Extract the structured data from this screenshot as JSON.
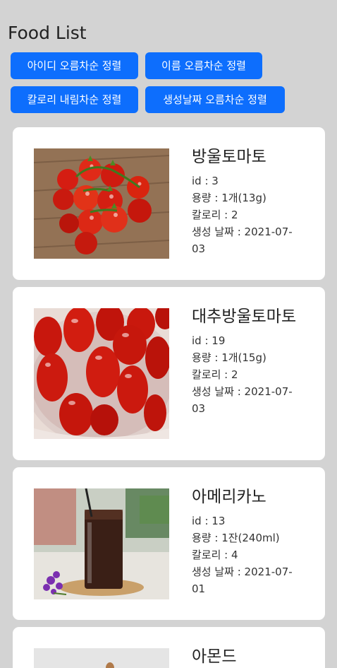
{
  "header": {
    "title": "Food List"
  },
  "sort_buttons": {
    "id_asc": "아이디 오름차순 정렬",
    "name_asc": "이름 오름차순 정렬",
    "calorie_desc": "칼로리 내림차순 정렬",
    "date_asc": "생성날짜 오름차순 정렬"
  },
  "foods": [
    {
      "name": "방울토마토",
      "id": "id : 3",
      "amount": "용량 : 1개(13g)",
      "calorie": "칼로리 : 2",
      "date": "생성 날짜 : 2021-07-03"
    },
    {
      "name": "대추방울토마토",
      "id": "id : 19",
      "amount": "용량 : 1개(15g)",
      "calorie": "칼로리 : 2",
      "date": "생성 날짜 : 2021-07-03"
    },
    {
      "name": "아메리카노",
      "id": "id : 13",
      "amount": "용량 : 1잔(240ml)",
      "calorie": "칼로리 : 4",
      "date": "생성 날짜 : 2021-07-01"
    },
    {
      "name": "아몬드"
    }
  ],
  "colors": {
    "background": "#d3d3d3",
    "button": "#0d6efd",
    "card": "#ffffff"
  }
}
